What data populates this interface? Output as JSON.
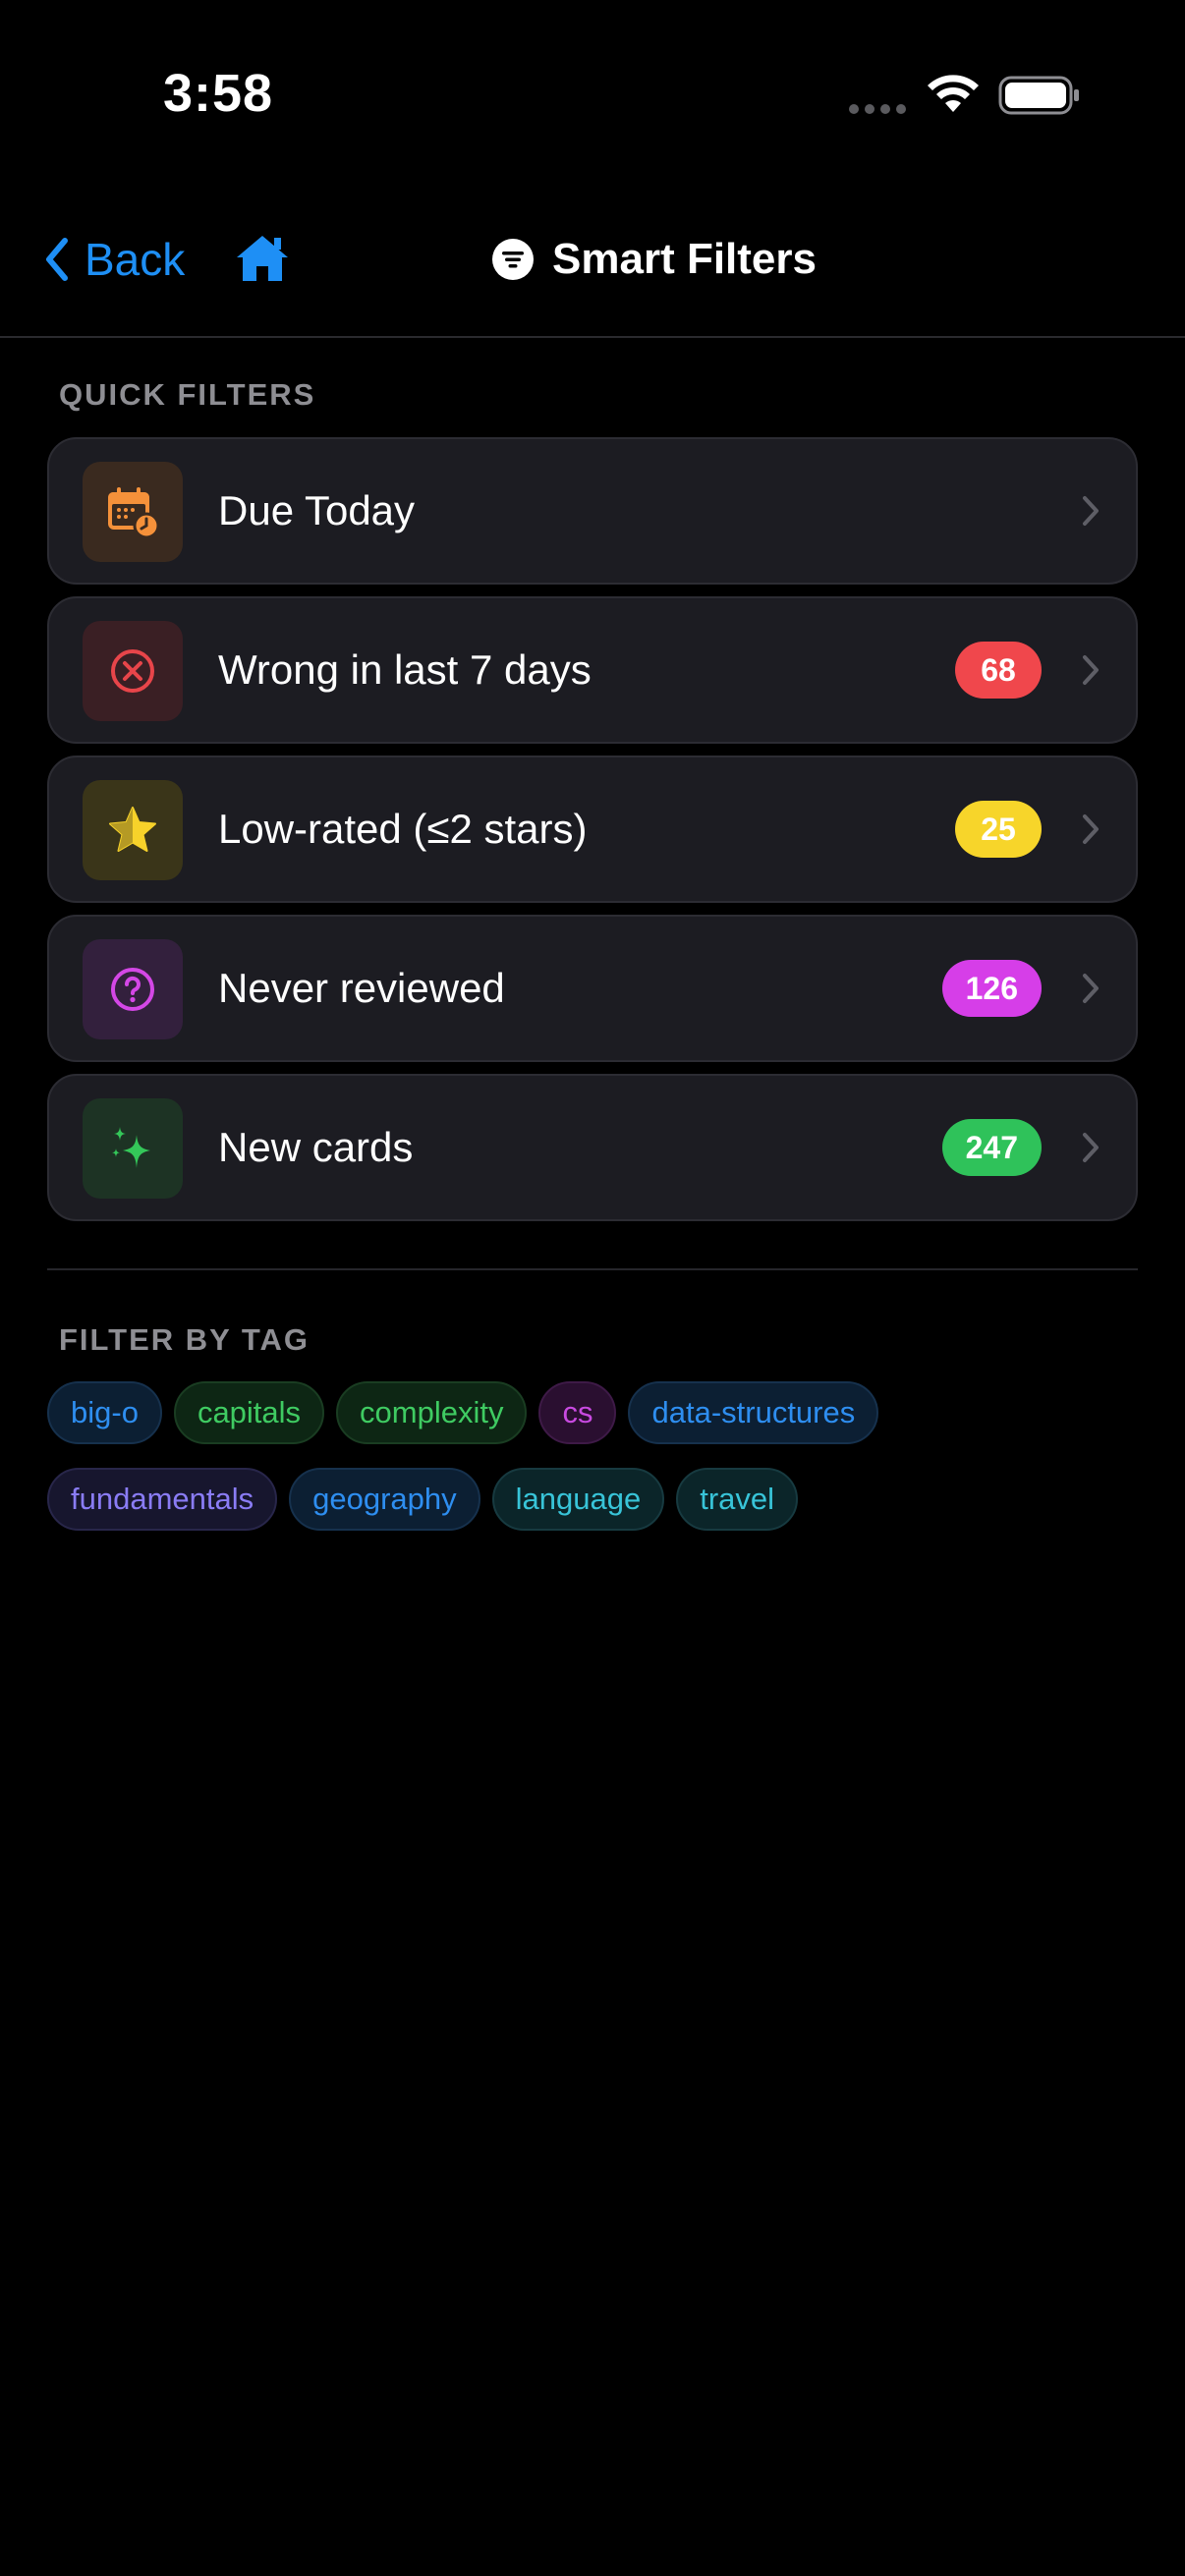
{
  "status_bar": {
    "time": "3:58"
  },
  "nav": {
    "back_label": "Back",
    "title": "Smart Filters"
  },
  "quick_filters": {
    "header": "QUICK FILTERS",
    "items": [
      {
        "label": "Due Today",
        "icon": "calendar-clock-icon",
        "accent": "#f5913a",
        "bg": "#3a2a1f",
        "badge": null,
        "badge_color": null,
        "badge_text_color": null
      },
      {
        "label": "Wrong in last 7 days",
        "icon": "x-circle-icon",
        "accent": "#e8454a",
        "bg": "#3a1f24",
        "badge": "68",
        "badge_color": "#f0474c",
        "badge_text_color": "#ffffff"
      },
      {
        "label": "Low-rated (≤2 stars)",
        "icon": "star-icon",
        "accent": "#f7d22a",
        "bg": "#3a3519",
        "badge": "25",
        "badge_color": "#f7d52a",
        "badge_text_color": "#ffffff"
      },
      {
        "label": "Never reviewed",
        "icon": "question-circle-icon",
        "accent": "#d447e6",
        "bg": "#33203d",
        "badge": "126",
        "badge_color": "#d63ee8",
        "badge_text_color": "#ffffff"
      },
      {
        "label": "New cards",
        "icon": "sparkles-icon",
        "accent": "#34c759",
        "bg": "#1d3324",
        "badge": "247",
        "badge_color": "#2fc25a",
        "badge_text_color": "#ffffff"
      }
    ]
  },
  "tags": {
    "header": "FILTER BY TAG",
    "items": [
      {
        "label": "big-o",
        "color": "#2e8ef0",
        "bg": "#0c1f33",
        "border": "#16314d"
      },
      {
        "label": "capitals",
        "color": "#3fcb62",
        "bg": "#0d2614",
        "border": "#1a3d22"
      },
      {
        "label": "complexity",
        "color": "#3fcb62",
        "bg": "#0d2614",
        "border": "#1a3d22"
      },
      {
        "label": "cs",
        "color": "#c84ae0",
        "bg": "#2a0f30",
        "border": "#3e1a47"
      },
      {
        "label": "data-structures",
        "color": "#2e8ef0",
        "bg": "#0c1f33",
        "border": "#16314d"
      },
      {
        "label": "fundamentals",
        "color": "#8a7cf5",
        "bg": "#17162e",
        "border": "#28264a"
      },
      {
        "label": "geography",
        "color": "#2e8ef0",
        "bg": "#0c1f33",
        "border": "#16314d"
      },
      {
        "label": "language",
        "color": "#38c4d8",
        "bg": "#0b2529",
        "border": "#173a40"
      },
      {
        "label": "travel",
        "color": "#38c4d8",
        "bg": "#0b2529",
        "border": "#173a40"
      }
    ]
  },
  "colors": {
    "accent_blue": "#1e8ff5",
    "background": "#000000",
    "card_bg": "#1c1c22"
  }
}
